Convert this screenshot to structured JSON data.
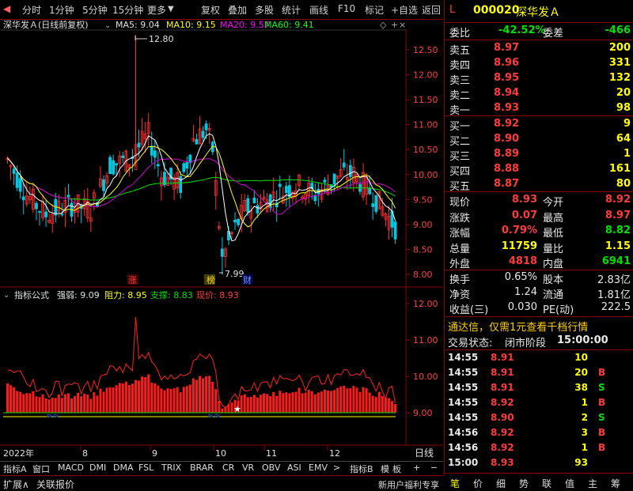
{
  "toolbar": {
    "left": [
      "分时",
      "1分钟",
      "5分钟",
      "15分钟",
      "更多"
    ],
    "right": [
      "复权",
      "叠加",
      "多股",
      "统计",
      "画线",
      "F10",
      "标记",
      "+自选",
      "返回"
    ]
  },
  "chart_header": {
    "name": "深华发Ａ(日线前复权)",
    "ma5": "MA5: 9.04",
    "ma10": "MA10: 9.15",
    "ma20": "MA20: 9.57",
    "ma60": "MA60: 9.41"
  },
  "price_axis": [
    "12.50",
    "12.00",
    "11.50",
    "11.00",
    "10.50",
    "10.00",
    "9.50",
    "9.00",
    "8.50",
    "8.00"
  ],
  "annotations": {
    "high": "12.80",
    "low": "7.99",
    "zhang": "涨",
    "bang": "榜",
    "cai": "财"
  },
  "indicator_header": {
    "name": "指标公式",
    "qr": "强弱: 9.09",
    "zl": "阻力: 8.95",
    "zc": "支撑: 8.83",
    "xj": "现价: 8.93"
  },
  "indicator_axis": [
    "12.00",
    "11.00",
    "10.00",
    "9.00"
  ],
  "date_axis": [
    "2022年",
    "8",
    "9",
    "10",
    "11",
    "12"
  ],
  "period_label": "日线",
  "bottom_tabs": [
    "指标A",
    "窗口",
    "MACD",
    "DMI",
    "DMA",
    "FSL",
    "TRIX",
    "BRAR",
    "CR",
    "VR",
    "OBV",
    "ASI",
    "EMV",
    ">",
    "指标B",
    "模",
    "板",
    "+",
    "−"
  ],
  "bottom_bar": {
    "expand": "扩展∧",
    "related": "关联报价",
    "promo": "新用户福利专享"
  },
  "quote": {
    "mark": "L",
    "code": "000020",
    "name": "深华发Ａ",
    "weibi_label": "委比",
    "weibi": "-42.52%",
    "weicha_label": "委差",
    "weicha": "-466",
    "asks": [
      {
        "label": "卖五",
        "price": "8.97",
        "vol": "200"
      },
      {
        "label": "卖四",
        "price": "8.96",
        "vol": "331"
      },
      {
        "label": "卖三",
        "price": "8.95",
        "vol": "132"
      },
      {
        "label": "卖二",
        "price": "8.94",
        "vol": "20"
      },
      {
        "label": "卖一",
        "price": "8.93",
        "vol": "98"
      }
    ],
    "bids": [
      {
        "label": "买一",
        "price": "8.92",
        "vol": "9"
      },
      {
        "label": "买二",
        "price": "8.90",
        "vol": "64"
      },
      {
        "label": "买三",
        "price": "8.89",
        "vol": "1"
      },
      {
        "label": "买四",
        "price": "8.88",
        "vol": "161"
      },
      {
        "label": "买五",
        "price": "8.87",
        "vol": "80"
      }
    ],
    "stats1": [
      {
        "l1": "现价",
        "v1": "8.93",
        "l2": "今开",
        "v2": "8.92"
      },
      {
        "l1": "涨跌",
        "v1": "0.07",
        "l2": "最高",
        "v2": "8.97"
      },
      {
        "l1": "涨幅",
        "v1": "0.79%",
        "l2": "最低",
        "v2": "8.82"
      },
      {
        "l1": "总量",
        "v1": "11759",
        "l2": "量比",
        "v2": "1.15"
      },
      {
        "l1": "外盘",
        "v1": "4818",
        "l2": "内盘",
        "v2": "6941"
      }
    ],
    "stats2": [
      {
        "l1": "换手",
        "v1": "0.65%",
        "l2": "股本",
        "v2": "2.83亿"
      },
      {
        "l1": "净资",
        "v1": "1.24",
        "l2": "流通",
        "v2": "1.81亿"
      },
      {
        "l1": "收益(三)",
        "v1": "0.030",
        "l2": "PE(动)",
        "v2": "222.5"
      }
    ],
    "promo": "通达信，仅需1元查看千档行情",
    "status_label": "交易状态:",
    "status": "闭市阶段",
    "status_time": "15:00:00",
    "ticks": [
      {
        "time": "14:55",
        "price": "8.91",
        "vol": "10",
        "side": ""
      },
      {
        "time": "14:55",
        "price": "8.91",
        "vol": "20",
        "side": "B"
      },
      {
        "time": "14:55",
        "price": "8.91",
        "vol": "38",
        "side": "S"
      },
      {
        "time": "14:55",
        "price": "8.92",
        "vol": "1",
        "side": "B"
      },
      {
        "time": "14:55",
        "price": "8.90",
        "vol": "2",
        "side": "S"
      },
      {
        "time": "14:56",
        "price": "8.92",
        "vol": "3",
        "side": "B"
      },
      {
        "time": "14:56",
        "price": "8.92",
        "vol": "1",
        "side": "B"
      },
      {
        "time": "15:00",
        "price": "8.93",
        "vol": "93",
        "side": ""
      }
    ],
    "tabs": [
      "笔",
      "价",
      "细",
      "势",
      "联",
      "值",
      "主",
      "筹"
    ]
  }
}
